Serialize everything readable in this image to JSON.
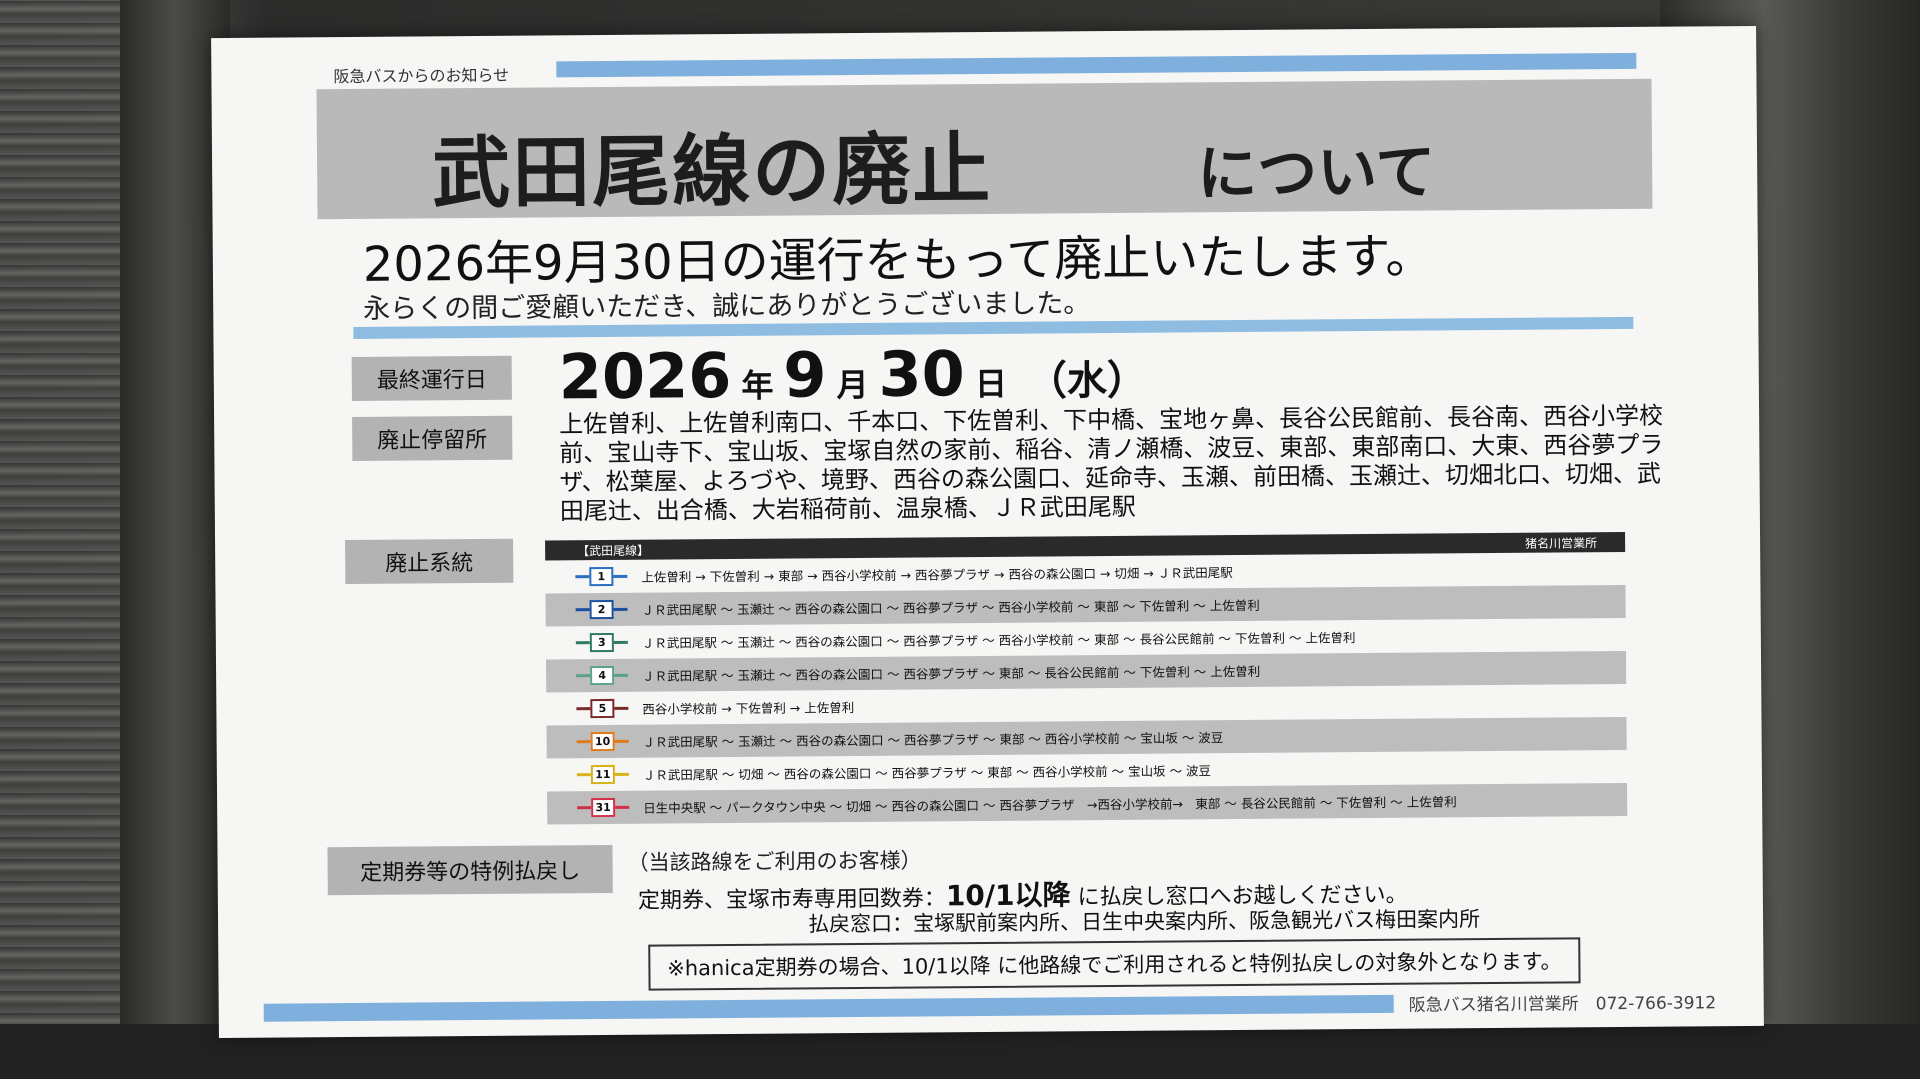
{
  "notice": {
    "from": "阪急バスからのお知らせ",
    "title_main": "武田尾線の廃止",
    "title_sub": "について",
    "headline": "2026年9月30日の運行をもって廃止いたします。",
    "subline": "永らくの間ご愛顧いただき、誠にありがとうございました。"
  },
  "final_day": {
    "label": "最終運行日",
    "year": "2026",
    "year_unit": "年",
    "month": "9",
    "month_unit": "月",
    "day": "30",
    "day_unit": "日",
    "weekday": "（水）"
  },
  "stops": {
    "label": "廃止停留所",
    "text": "上佐曽利、上佐曽利南口、千本口、下佐曽利、下中橋、宝地ヶ鼻、長谷公民館前、長谷南、西谷小学校前、宝山寺下、宝山坂、宝塚自然の家前、稲谷、清ノ瀬橋、波豆、東部、東部南口、大東、西谷夢プラザ、松葉屋、よろづや、境野、西谷の森公園口、延命寺、玉瀬、前田橋、玉瀬辻、切畑北口、切畑、武田尾辻、出合橋、大岩稲荷前、温泉橋、ＪＲ武田尾駅"
  },
  "routes": {
    "label": "廃止系統",
    "table_title": "【武田尾線】",
    "office_tag": "猪名川営業所",
    "rows": [
      {
        "num": "1",
        "color": "#2a6fc0",
        "text": "上佐曽利 → 下佐曽利 → 東部 → 西谷小学校前 → 西谷夢プラザ → 西谷の森公園口 → 切畑 → ＪＲ武田尾駅"
      },
      {
        "num": "2",
        "color": "#1f4fa0",
        "text": "ＪＲ武田尾駅 ～ 玉瀬辻 ～ 西谷の森公園口 ～ 西谷夢プラザ ～ 西谷小学校前 ～ 東部 ～ 下佐曽利 ～ 上佐曽利"
      },
      {
        "num": "3",
        "color": "#2f7a60",
        "text": "ＪＲ武田尾駅 ～ 玉瀬辻 ～ 西谷の森公園口 ～ 西谷夢プラザ ～ 西谷小学校前 ～ 東部 ～ 長谷公民館前 ～ 下佐曽利 ～ 上佐曽利"
      },
      {
        "num": "4",
        "color": "#5aa08a",
        "text": "ＪＲ武田尾駅 ～ 玉瀬辻 ～ 西谷の森公園口 ～ 西谷夢プラザ ～ 東部 ～ 長谷公民館前 ～ 下佐曽利 ～ 上佐曽利"
      },
      {
        "num": "5",
        "color": "#7a2a2a",
        "text": "西谷小学校前 → 下佐曽利 → 上佐曽利"
      },
      {
        "num": "10",
        "color": "#e07a1a",
        "text": "ＪＲ武田尾駅 ～ 玉瀬辻 ～ 西谷の森公園口 ～ 西谷夢プラザ ～ 東部 ～ 西谷小学校前 ～ 宝山坂 ～ 波豆"
      },
      {
        "num": "11",
        "color": "#d8b21a",
        "text": "ＪＲ武田尾駅 ～ 切畑 ～ 西谷の森公園口 ～ 西谷夢プラザ ～ 東部 ～ 西谷小学校前 ～ 宝山坂 ～ 波豆"
      },
      {
        "num": "31",
        "color": "#d0304a",
        "text": "日生中央駅 ～ パークタウン中央 ～ 切畑 ～ 西谷の森公園口 ～ 西谷夢プラザ　→西谷小学校前→　東部 ～ 長谷公民館前 ～ 下佐曽利 ～ 上佐曽利"
      }
    ]
  },
  "refund": {
    "label": "定期券等の特例払戻し",
    "note": "（当該路線をご利用のお客様）",
    "line1_pre": "定期券、宝塚市寿専用回数券：",
    "line1_emph": "10/1以降",
    "line1_post": " に払戻し窓口へお越しください。",
    "line2": "払戻窓口：宝塚駅前案内所、日生中央案内所、阪急観光バス梅田案内所",
    "hanica": "※hanica定期券の場合、10/1以降 に他路線でご利用されると特例払戻しの対象外となります。"
  },
  "footer": {
    "office": "阪急バス猪名川営業所　072-766-3912"
  }
}
